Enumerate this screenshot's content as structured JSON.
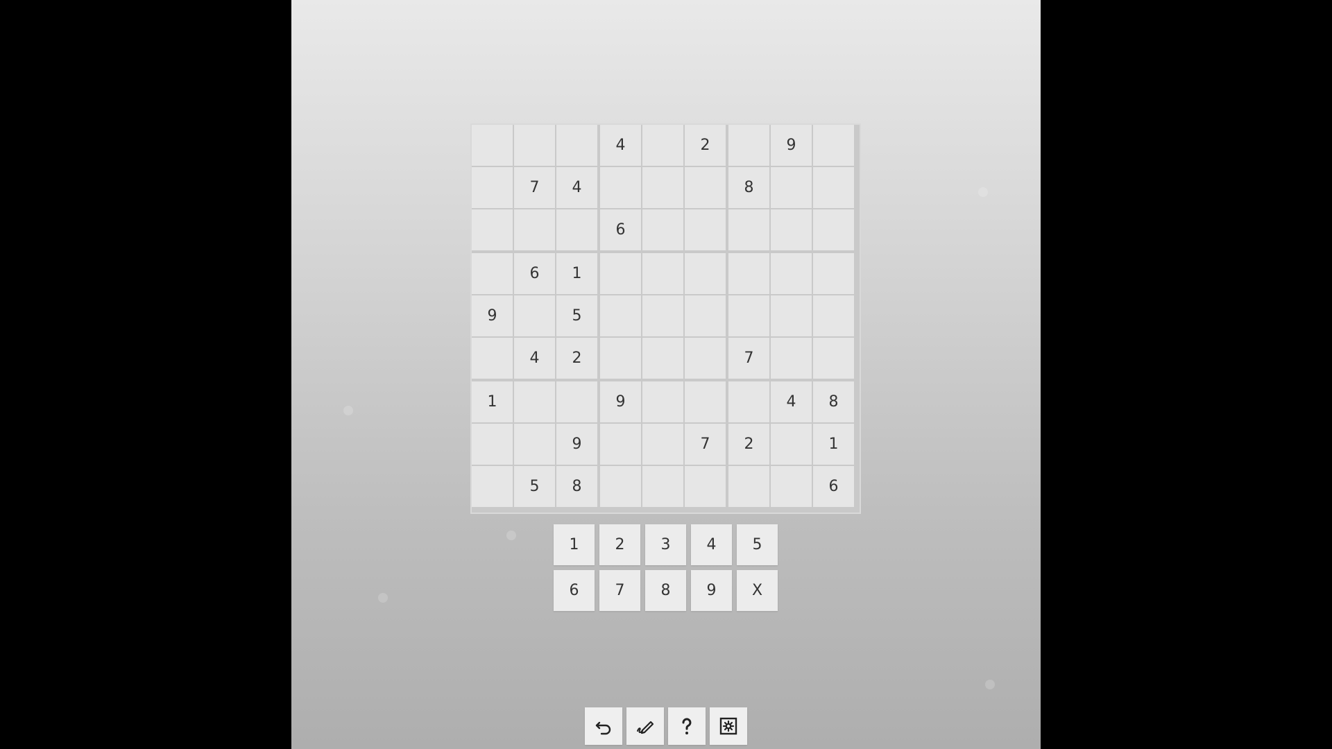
{
  "board": {
    "rows": [
      [
        "",
        "",
        "",
        "4",
        "",
        "2",
        "",
        "9",
        ""
      ],
      [
        "",
        "7",
        "4",
        "",
        "",
        "",
        "8",
        "",
        ""
      ],
      [
        "",
        "",
        "",
        "6",
        "",
        "",
        "",
        "",
        ""
      ],
      [
        "",
        "6",
        "1",
        "",
        "",
        "",
        "",
        "",
        ""
      ],
      [
        "9",
        "",
        "5",
        "",
        "",
        "",
        "",
        "",
        ""
      ],
      [
        "",
        "4",
        "2",
        "",
        "",
        "",
        "7",
        "",
        ""
      ],
      [
        "1",
        "",
        "",
        "9",
        "",
        "",
        "",
        "4",
        "8"
      ],
      [
        "",
        "",
        "9",
        "",
        "",
        "7",
        "2",
        "",
        "1"
      ],
      [
        "",
        "5",
        "8",
        "",
        "",
        "",
        "",
        "",
        "6"
      ]
    ]
  },
  "number_pad": {
    "buttons": [
      "1",
      "2",
      "3",
      "4",
      "5",
      "6",
      "7",
      "8",
      "9",
      "X"
    ]
  },
  "toolbar": {
    "buttons": [
      {
        "name": "undo",
        "icon": "undo-icon"
      },
      {
        "name": "pencil",
        "icon": "pencil-icon"
      },
      {
        "name": "help",
        "icon": "question-icon"
      },
      {
        "name": "settings",
        "icon": "gear-icon"
      }
    ]
  },
  "colors": {
    "cell_background": "#e6e6e6",
    "text": "#333333",
    "frame_background": "#000000"
  }
}
